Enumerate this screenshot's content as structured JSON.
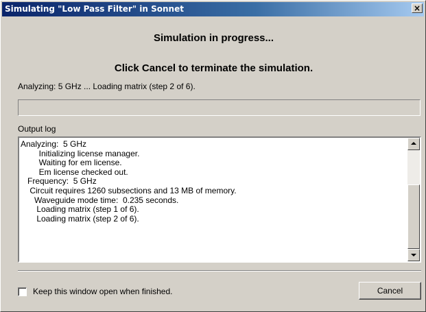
{
  "window": {
    "title": "Simulating \"Low Pass Filter\" in Sonnet",
    "close_glyph": "×"
  },
  "headings": {
    "progress": "Simulation in progress...",
    "instruction": "Click Cancel to terminate the simulation."
  },
  "status": {
    "text": "Analyzing:  5 GHz ... Loading matrix (step 2 of 6).",
    "progress_fraction": 0
  },
  "log": {
    "label": "Output log",
    "lines": [
      "Analyzing:  5 GHz",
      "        Initializing license manager.",
      "        Waiting for em license.",
      "        Em license checked out.",
      "   Frequency:  5 GHz",
      "    Circuit requires 1260 subsections and 13 MB of memory.",
      "      Waveguide mode time:  0.235 seconds.",
      "       Loading matrix (step 1 of 6).",
      "       Loading matrix (step 2 of 6)."
    ]
  },
  "footer": {
    "keep_open_label": "Keep this window open when finished.",
    "keep_open_checked": false,
    "cancel_label": "Cancel"
  },
  "colors": {
    "titlebar": "#0a246a",
    "face": "#d4d0c8"
  },
  "icons": {
    "close": "close-icon",
    "scroll_up": "arrow-up-icon",
    "scroll_down": "arrow-down-icon"
  }
}
